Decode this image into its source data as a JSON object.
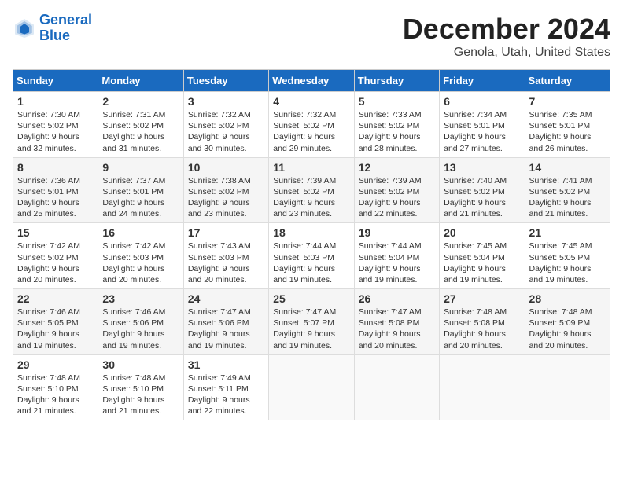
{
  "header": {
    "logo_line1": "General",
    "logo_line2": "Blue",
    "month": "December 2024",
    "location": "Genola, Utah, United States"
  },
  "days_of_week": [
    "Sunday",
    "Monday",
    "Tuesday",
    "Wednesday",
    "Thursday",
    "Friday",
    "Saturday"
  ],
  "weeks": [
    [
      {
        "day": "1",
        "info": "Sunrise: 7:30 AM\nSunset: 5:02 PM\nDaylight: 9 hours\nand 32 minutes."
      },
      {
        "day": "2",
        "info": "Sunrise: 7:31 AM\nSunset: 5:02 PM\nDaylight: 9 hours\nand 31 minutes."
      },
      {
        "day": "3",
        "info": "Sunrise: 7:32 AM\nSunset: 5:02 PM\nDaylight: 9 hours\nand 30 minutes."
      },
      {
        "day": "4",
        "info": "Sunrise: 7:32 AM\nSunset: 5:02 PM\nDaylight: 9 hours\nand 29 minutes."
      },
      {
        "day": "5",
        "info": "Sunrise: 7:33 AM\nSunset: 5:02 PM\nDaylight: 9 hours\nand 28 minutes."
      },
      {
        "day": "6",
        "info": "Sunrise: 7:34 AM\nSunset: 5:01 PM\nDaylight: 9 hours\nand 27 minutes."
      },
      {
        "day": "7",
        "info": "Sunrise: 7:35 AM\nSunset: 5:01 PM\nDaylight: 9 hours\nand 26 minutes."
      }
    ],
    [
      {
        "day": "8",
        "info": "Sunrise: 7:36 AM\nSunset: 5:01 PM\nDaylight: 9 hours\nand 25 minutes."
      },
      {
        "day": "9",
        "info": "Sunrise: 7:37 AM\nSunset: 5:01 PM\nDaylight: 9 hours\nand 24 minutes."
      },
      {
        "day": "10",
        "info": "Sunrise: 7:38 AM\nSunset: 5:02 PM\nDaylight: 9 hours\nand 23 minutes."
      },
      {
        "day": "11",
        "info": "Sunrise: 7:39 AM\nSunset: 5:02 PM\nDaylight: 9 hours\nand 23 minutes."
      },
      {
        "day": "12",
        "info": "Sunrise: 7:39 AM\nSunset: 5:02 PM\nDaylight: 9 hours\nand 22 minutes."
      },
      {
        "day": "13",
        "info": "Sunrise: 7:40 AM\nSunset: 5:02 PM\nDaylight: 9 hours\nand 21 minutes."
      },
      {
        "day": "14",
        "info": "Sunrise: 7:41 AM\nSunset: 5:02 PM\nDaylight: 9 hours\nand 21 minutes."
      }
    ],
    [
      {
        "day": "15",
        "info": "Sunrise: 7:42 AM\nSunset: 5:02 PM\nDaylight: 9 hours\nand 20 minutes."
      },
      {
        "day": "16",
        "info": "Sunrise: 7:42 AM\nSunset: 5:03 PM\nDaylight: 9 hours\nand 20 minutes."
      },
      {
        "day": "17",
        "info": "Sunrise: 7:43 AM\nSunset: 5:03 PM\nDaylight: 9 hours\nand 20 minutes."
      },
      {
        "day": "18",
        "info": "Sunrise: 7:44 AM\nSunset: 5:03 PM\nDaylight: 9 hours\nand 19 minutes."
      },
      {
        "day": "19",
        "info": "Sunrise: 7:44 AM\nSunset: 5:04 PM\nDaylight: 9 hours\nand 19 minutes."
      },
      {
        "day": "20",
        "info": "Sunrise: 7:45 AM\nSunset: 5:04 PM\nDaylight: 9 hours\nand 19 minutes."
      },
      {
        "day": "21",
        "info": "Sunrise: 7:45 AM\nSunset: 5:05 PM\nDaylight: 9 hours\nand 19 minutes."
      }
    ],
    [
      {
        "day": "22",
        "info": "Sunrise: 7:46 AM\nSunset: 5:05 PM\nDaylight: 9 hours\nand 19 minutes."
      },
      {
        "day": "23",
        "info": "Sunrise: 7:46 AM\nSunset: 5:06 PM\nDaylight: 9 hours\nand 19 minutes."
      },
      {
        "day": "24",
        "info": "Sunrise: 7:47 AM\nSunset: 5:06 PM\nDaylight: 9 hours\nand 19 minutes."
      },
      {
        "day": "25",
        "info": "Sunrise: 7:47 AM\nSunset: 5:07 PM\nDaylight: 9 hours\nand 19 minutes."
      },
      {
        "day": "26",
        "info": "Sunrise: 7:47 AM\nSunset: 5:08 PM\nDaylight: 9 hours\nand 20 minutes."
      },
      {
        "day": "27",
        "info": "Sunrise: 7:48 AM\nSunset: 5:08 PM\nDaylight: 9 hours\nand 20 minutes."
      },
      {
        "day": "28",
        "info": "Sunrise: 7:48 AM\nSunset: 5:09 PM\nDaylight: 9 hours\nand 20 minutes."
      }
    ],
    [
      {
        "day": "29",
        "info": "Sunrise: 7:48 AM\nSunset: 5:10 PM\nDaylight: 9 hours\nand 21 minutes."
      },
      {
        "day": "30",
        "info": "Sunrise: 7:48 AM\nSunset: 5:10 PM\nDaylight: 9 hours\nand 21 minutes."
      },
      {
        "day": "31",
        "info": "Sunrise: 7:49 AM\nSunset: 5:11 PM\nDaylight: 9 hours\nand 22 minutes."
      },
      {
        "day": "",
        "info": ""
      },
      {
        "day": "",
        "info": ""
      },
      {
        "day": "",
        "info": ""
      },
      {
        "day": "",
        "info": ""
      }
    ]
  ]
}
